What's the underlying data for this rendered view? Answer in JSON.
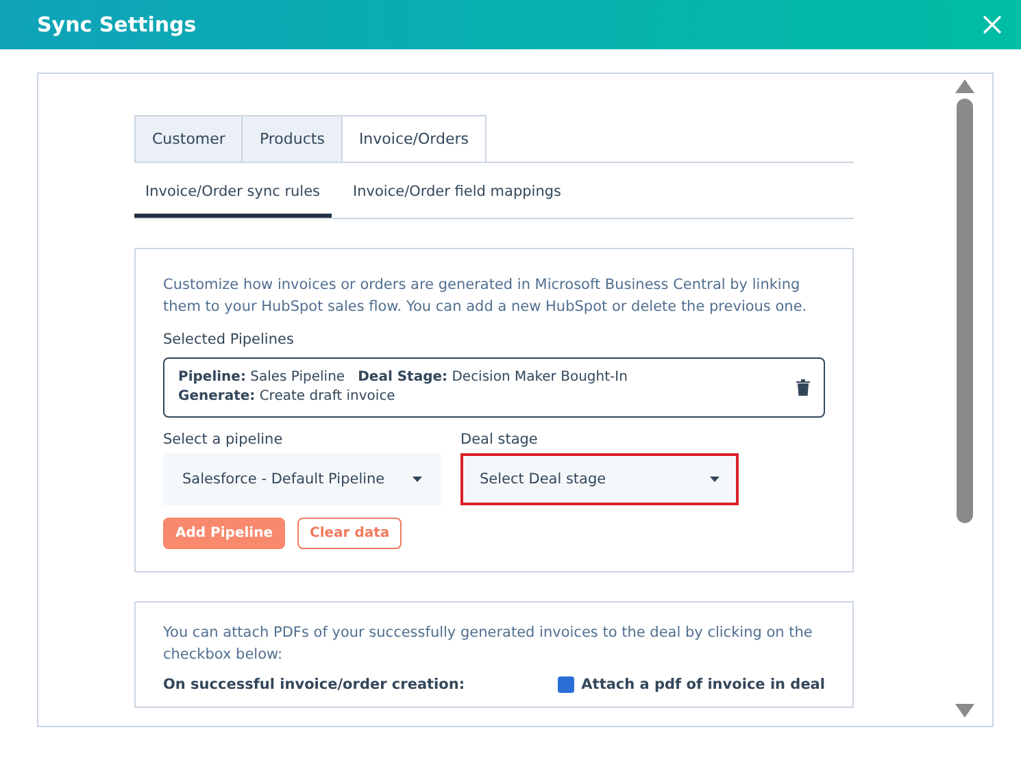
{
  "window": {
    "title": "Sync Settings"
  },
  "tabs": [
    {
      "label": "Customer",
      "selected": false
    },
    {
      "label": "Products",
      "selected": false
    },
    {
      "label": "Invoice/Orders",
      "selected": true
    }
  ],
  "subtabs": [
    {
      "label": "Invoice/Order sync rules",
      "selected": true
    },
    {
      "label": "Invoice/Order field mappings",
      "selected": false
    }
  ],
  "rules_card": {
    "description": "Customize how invoices or orders are generated in Microsoft Business Central by linking them to your HubSpot sales flow. You can add a new HubSpot or delete the previous one.",
    "selected_pipelines_label": "Selected Pipelines",
    "selected_pipelines": [
      {
        "text": "**Pipeline:** Sales Pipeline   **Deal Stage:** Decision Maker Bought-In",
        "text2": "**Generate:** Create draft invoice"
      }
    ],
    "pipeline_select": {
      "label": "Select a pipeline",
      "value": "Salesforce - Default Pipeline",
      "highlighted": false
    },
    "stage_select": {
      "label": "Deal stage",
      "value": "Select Deal stage",
      "highlighted": true
    },
    "buttons": [
      {
        "label": "Add Pipeline",
        "kind": "primary"
      },
      {
        "label": "Clear data",
        "kind": "secondary"
      }
    ]
  },
  "pdf_card": {
    "description": "You can attach PDFs of your successfully generated invoices to the deal by clicking on the checkbox below:",
    "row_label": "On successful invoice/order creation:",
    "checkbox": {
      "label": "Attach a pdf of invoice in deal",
      "checked": true
    }
  }
}
